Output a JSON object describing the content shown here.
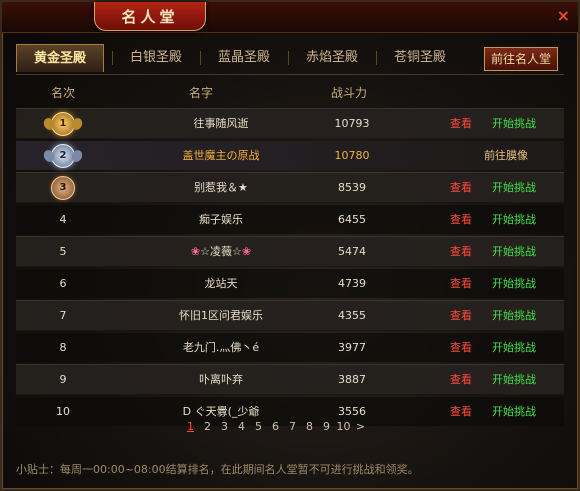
{
  "window": {
    "title": "名人堂",
    "close_icon": "×"
  },
  "tabs": [
    {
      "label": "黄金圣殿",
      "active": true
    },
    {
      "label": "白银圣殿",
      "active": false
    },
    {
      "label": "蓝晶圣殿",
      "active": false
    },
    {
      "label": "赤焰圣殿",
      "active": false
    },
    {
      "label": "苍铜圣殿",
      "active": false
    }
  ],
  "goto_button": "前往名人堂",
  "columns": {
    "rank": "名次",
    "name": "名字",
    "power": "战斗力"
  },
  "rows": [
    {
      "rank": "1",
      "medal": "gold",
      "name": "往事随风逝",
      "power": "10793",
      "view": "查看",
      "action": "开始挑战"
    },
    {
      "rank": "2",
      "medal": "silver",
      "name": "盖世魔主の原战",
      "power": "10780",
      "view": "",
      "action": "前往膜像"
    },
    {
      "rank": "3",
      "medal": "bronze",
      "name": "别惹我＆★",
      "power": "8539",
      "view": "查看",
      "action": "开始挑战"
    },
    {
      "rank": "4",
      "medal": "",
      "name": "痴子娱乐",
      "power": "6455",
      "view": "查看",
      "action": "开始挑战"
    },
    {
      "rank": "5",
      "medal": "",
      "name": "☆凌薇☆",
      "power": "5474",
      "view": "查看",
      "action": "开始挑战"
    },
    {
      "rank": "6",
      "medal": "",
      "name": "龙站天",
      "power": "4739",
      "view": "查看",
      "action": "开始挑战"
    },
    {
      "rank": "7",
      "medal": "",
      "name": "怀旧1区问君娱乐",
      "power": "4355",
      "view": "查看",
      "action": "开始挑战"
    },
    {
      "rank": "8",
      "medal": "",
      "name": "老九门.灬佛丶é",
      "power": "3977",
      "view": "查看",
      "action": "开始挑战"
    },
    {
      "rank": "9",
      "medal": "",
      "name": "卟离卟弃",
      "power": "3887",
      "view": "查看",
      "action": "开始挑战"
    },
    {
      "rank": "10",
      "medal": "",
      "name": "D ぐ天釁(_少爺",
      "power": "3556",
      "view": "查看",
      "action": "开始挑战"
    }
  ],
  "pagination": {
    "pages": [
      "1",
      "2",
      "3",
      "4",
      "5",
      "6",
      "7",
      "8",
      "9",
      "10"
    ],
    "current": "1",
    "next": ">"
  },
  "tip": "小贴士：每周一00:00~08:00结算排名，在此期间名人堂暂不可进行挑战和领奖。",
  "colors": {
    "view": "#ff4a3a",
    "challenge": "#46e04a",
    "highlight": "#f3b03a"
  }
}
